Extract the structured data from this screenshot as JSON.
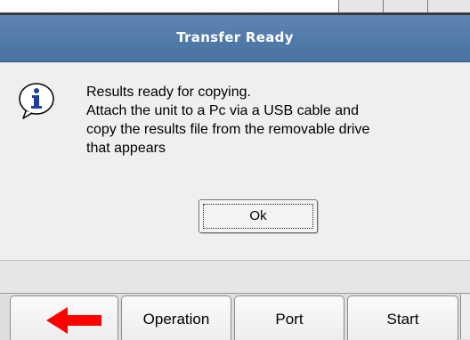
{
  "dialog": {
    "title": "Transfer Ready",
    "icon": "info-icon",
    "message_lines": [
      "Results ready for copying.",
      "Attach the unit to a Pc via a USB cable and",
      "copy the results file from the removable drive",
      "that appears"
    ],
    "ok_label": "Ok"
  },
  "toolbar": {
    "back_icon": "red-left-arrow-icon",
    "buttons": [
      {
        "label": "Operation"
      },
      {
        "label": "Port"
      },
      {
        "label": "Start"
      }
    ]
  },
  "colors": {
    "titlebar": "#4f79a8",
    "title_text": "#ffffff",
    "dialog_background": "#efefef",
    "arrow_red": "#ff0000",
    "icon_blue": "#1f3f9a"
  }
}
